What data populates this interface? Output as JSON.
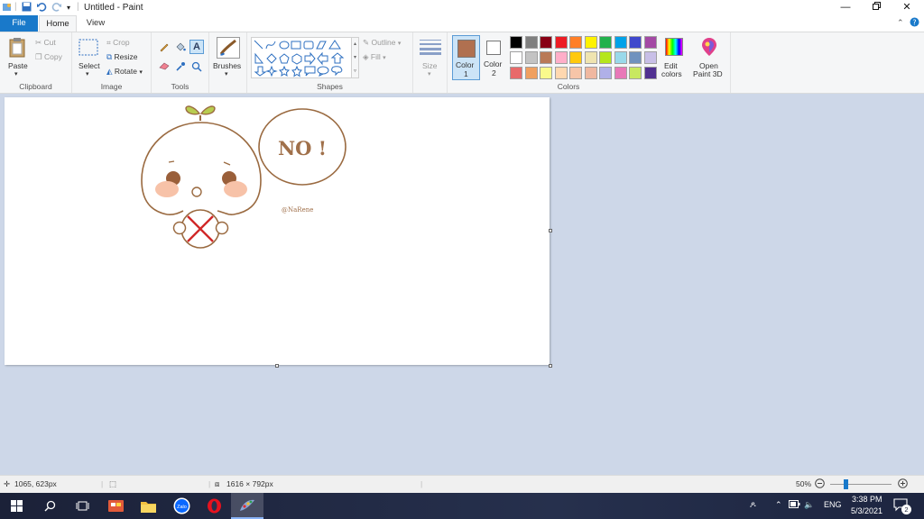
{
  "window": {
    "title": "Untitled - Paint",
    "minimize_icon": "minimize-icon",
    "maximize_icon": "restore-icon",
    "close_icon": "close-icon"
  },
  "tabs": {
    "file": "File",
    "home": "Home",
    "view": "View"
  },
  "clipboard": {
    "paste": "Paste",
    "cut": "Cut",
    "copy": "Copy",
    "label": "Clipboard"
  },
  "image": {
    "select": "Select",
    "crop": "Crop",
    "resize": "Resize",
    "rotate": "Rotate",
    "label": "Image"
  },
  "tools": {
    "label": "Tools"
  },
  "brushes": {
    "label": "Brushes"
  },
  "shapes": {
    "outline": "Outline",
    "fill": "Fill",
    "label": "Shapes"
  },
  "size": {
    "label": "Size"
  },
  "colors": {
    "color1": "Color",
    "color1_num": "1",
    "color2": "Color",
    "color2_num": "2",
    "edit": "Edit",
    "edit2": "colors",
    "paint3d": "Open",
    "paint3d2": "Paint 3D",
    "label": "Colors",
    "color1_value": "#b07050",
    "color2_value": "#ffffff",
    "palette_row1": [
      "#000000",
      "#7f7f7f",
      "#880015",
      "#ed1c24",
      "#ff7f27",
      "#fff200",
      "#22b14c",
      "#00a2e8",
      "#3f48cc",
      "#a349a4"
    ],
    "palette_row2": [
      "#ffffff",
      "#c3c3c3",
      "#b97a57",
      "#ffaec9",
      "#ffc90e",
      "#efe4b0",
      "#b5e61d",
      "#99d9ea",
      "#7092be",
      "#c8bfe7"
    ],
    "palette_row3": [
      "#e86a6a",
      "#f0a060",
      "#fafa8c",
      "#ffd8b0",
      "#f7c5a8",
      "#f0b8a0",
      "#b0b0e8",
      "#e878b8",
      "#c8e860",
      "#503090"
    ]
  },
  "canvas_art": {
    "bubble_text": "NO !",
    "signature": "@NaRene"
  },
  "status": {
    "cursor": "1065, 623px",
    "canvas_size": "1616 × 792px",
    "zoom": "50%"
  },
  "tray": {
    "lang": "ENG",
    "time": "3:38 PM",
    "date": "5/3/2021",
    "notif_count": "2"
  }
}
